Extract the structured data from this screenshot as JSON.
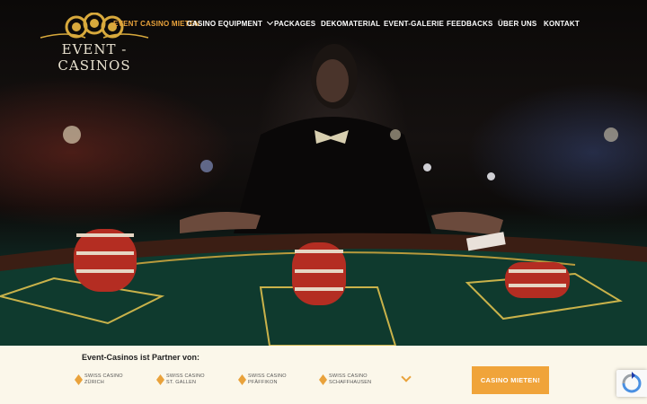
{
  "brand": {
    "logo_text": "EVENT - CASINOS"
  },
  "nav": {
    "items": [
      {
        "label": "EVENT CASINO MIETEN",
        "active": true
      },
      {
        "label": "CASINO EQUIPMENT",
        "has_dropdown": true
      },
      {
        "label": "PACKAGES"
      },
      {
        "label": "DEKOMATERIAL"
      },
      {
        "label": "EVENT-GALERIE"
      },
      {
        "label": "FEEDBACKS"
      },
      {
        "label": "ÜBER UNS"
      },
      {
        "label": "KONTAKT"
      }
    ]
  },
  "partners": {
    "title": "Event-Casinos ist Partner von:",
    "items": [
      {
        "line1": "SWISS CASINO",
        "line2": "ZÜRICH"
      },
      {
        "line1": "SWISS CASINO",
        "line2": "ST. GALLEN"
      },
      {
        "line1": "SWISS CASINO",
        "line2": "PFÄFFIKON"
      },
      {
        "line1": "SWISS CASINO",
        "line2": "SCHAFFHAUSEN"
      }
    ]
  },
  "cta": {
    "label": "CASINO MIETEN!"
  },
  "colors": {
    "accent": "#f0a43a",
    "bar_bg": "#fbf7ea",
    "felt": "#123228"
  },
  "icons": {
    "more": "chevron-down-icon",
    "partner": "diamond-icon",
    "recaptcha": "recaptcha-icon"
  }
}
